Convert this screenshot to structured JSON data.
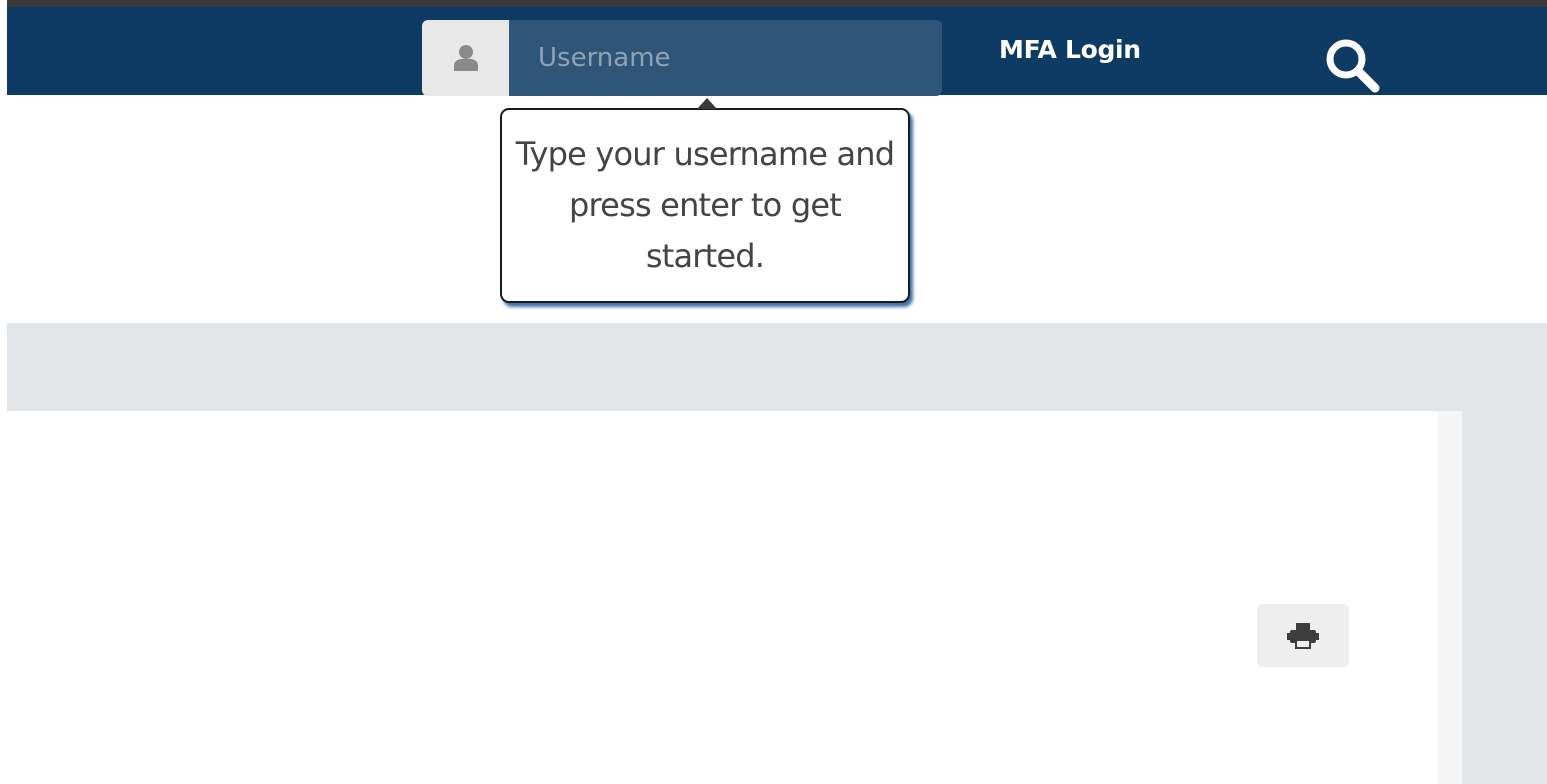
{
  "header": {
    "username_field": {
      "placeholder": "Username",
      "value": "",
      "icon": "user-icon"
    },
    "mfa_login_label": "MFA Login",
    "search_icon": "search-icon"
  },
  "tooltip": {
    "text": "Type your username and press enter to get started."
  },
  "toolbar": {
    "print_icon": "print-icon"
  },
  "colors": {
    "navbar": "#0e3b63",
    "input_bg": "#2f5678",
    "band": "#e1e5e8",
    "tooltip_shadow": "#1e5a96"
  }
}
